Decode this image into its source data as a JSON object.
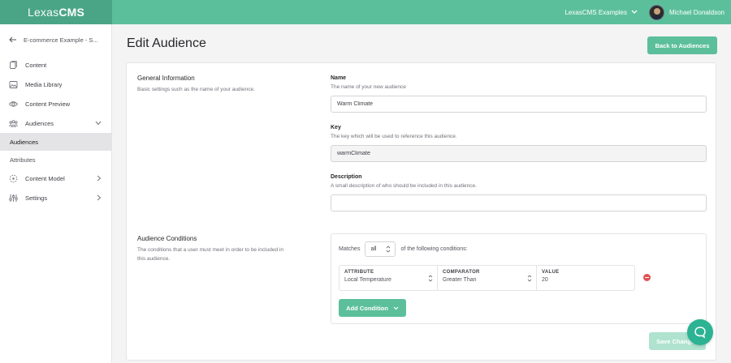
{
  "app": {
    "logo_light": "Lexas",
    "logo_bold": "CMS",
    "workspace": "LexasCMS Examples",
    "user_name": "Michael Donaldson"
  },
  "sidebar": {
    "back_label": "E-commerce Example - S...",
    "items": [
      {
        "label": "Content",
        "icon": "document-icon"
      },
      {
        "label": "Media Library",
        "icon": "image-icon"
      },
      {
        "label": "Content Preview",
        "icon": "eye-icon"
      },
      {
        "label": "Audiences",
        "icon": "users-icon"
      },
      {
        "label": "Content Model",
        "icon": "model-icon"
      },
      {
        "label": "Settings",
        "icon": "sliders-icon"
      }
    ],
    "sub_items": [
      "Audiences",
      "Attributes"
    ]
  },
  "page": {
    "title": "Edit Audience",
    "back_button": "Back to Audiences"
  },
  "general": {
    "title": "General Information",
    "description": "Basic settings such as the name of your audience.",
    "name_label": "Name",
    "name_help": "The name of your new audience",
    "name_value": "Warm Climate",
    "key_label": "Key",
    "key_help": "The key which will be used to reference this audience.",
    "key_value": "warmClimate",
    "desc_label": "Description",
    "desc_help": "A small description of who should be included in this audience.",
    "desc_value": ""
  },
  "conditions": {
    "title": "Audience Conditions",
    "description_line1": "The conditions that a user must meet in order to be included in",
    "description_line2": "this audience.",
    "matches_label": "Matches",
    "matches_value": "all",
    "matches_suffix": "of the following conditions:",
    "row": {
      "attribute_head": "ATTRIBUTE",
      "attribute_value": "Local Temperature",
      "comparator_head": "COMPARATOR",
      "comparator_value": "Greater Than",
      "value_head": "VALUE",
      "value_value": "20"
    },
    "add_button": "Add Condition",
    "save_button": "Save Changes"
  },
  "colors": {
    "accent": "#5cbf9c",
    "danger": "#e05252"
  }
}
